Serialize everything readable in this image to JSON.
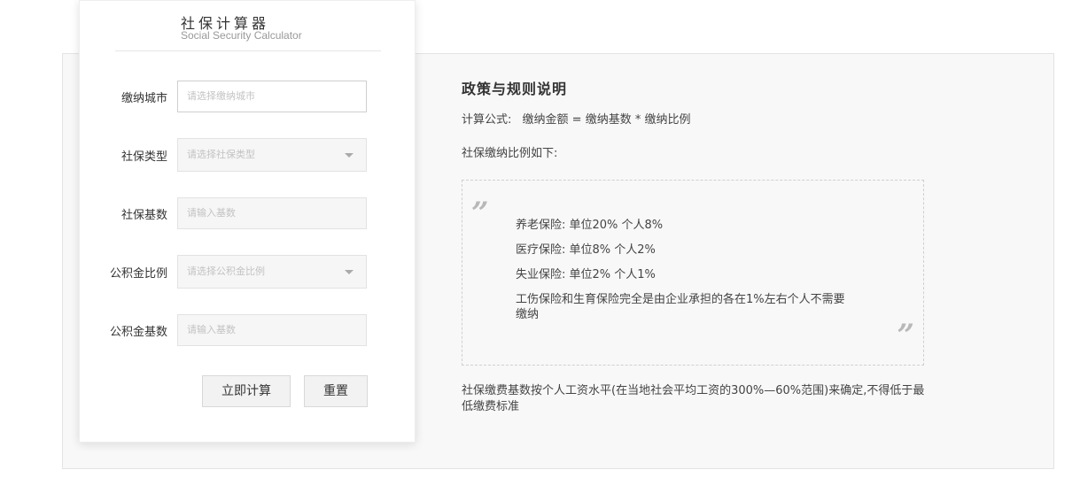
{
  "calculator": {
    "title": "社保计算器",
    "subtitle": "Social Security Calculator",
    "fields": [
      {
        "label": "缴纳城市",
        "placeholder": "请选择缴纳城市"
      },
      {
        "label": "社保类型",
        "placeholder": "请选择社保类型"
      },
      {
        "label": "社保基数",
        "placeholder": "请输入基数"
      },
      {
        "label": "公积金比例",
        "placeholder": "请选择公积金比例"
      },
      {
        "label": "公积金基数",
        "placeholder": "请输入基数"
      }
    ],
    "calculate_label": "立即计算",
    "reset_label": "重置"
  },
  "policy": {
    "title": "政策与规则说明",
    "formula_label": "计算公式:",
    "formula": "缴纳金额 = 缴纳基数 * 缴纳比例",
    "rates_intro": "社保缴纳比例如下:",
    "open_quote": "”",
    "close_quote": "”",
    "rates": [
      "养老保险: 单位20% 个人8%",
      "医疗保险: 单位8% 个人2%",
      "失业保险: 单位2% 个人1%"
    ],
    "note": "工伤保险和生育保险完全是由企业承担的各在1%左右个人不需要缴纳",
    "footer": "社保缴费基数按个人工资水平(在当地社会平均工资的300%—60%范围)来确定,不得低于最低缴费标准"
  }
}
